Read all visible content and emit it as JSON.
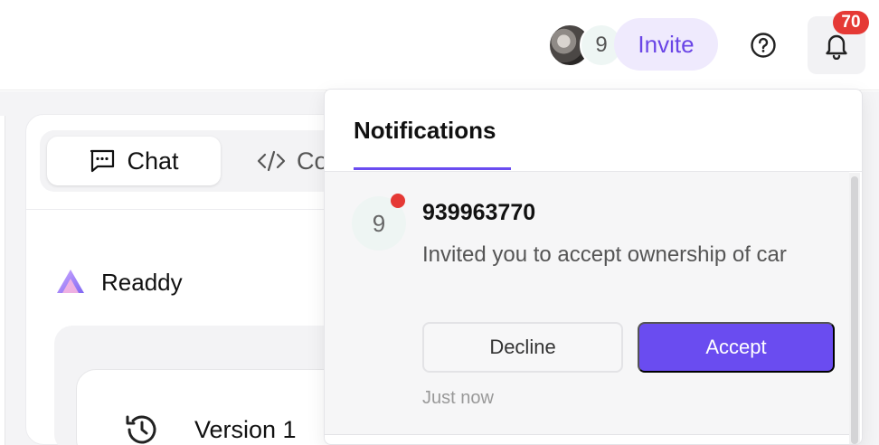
{
  "header": {
    "collaborator_count": "9",
    "invite_label": "Invite",
    "notification_count": "70"
  },
  "tabs": [
    {
      "label": "Chat"
    },
    {
      "label": "Co"
    }
  ],
  "brand": {
    "name": "Readdy"
  },
  "version": {
    "label": "Version 1"
  },
  "notifications": {
    "title": "Notifications",
    "items": [
      {
        "avatar_text": "9",
        "title": "939963770",
        "message": "Invited you to accept ownership of car",
        "decline_label": "Decline",
        "accept_label": "Accept",
        "time": "Just now"
      }
    ]
  },
  "colors": {
    "accent": "#6a4cf0",
    "badge": "#e53935",
    "invite_bg": "#efeafd"
  }
}
